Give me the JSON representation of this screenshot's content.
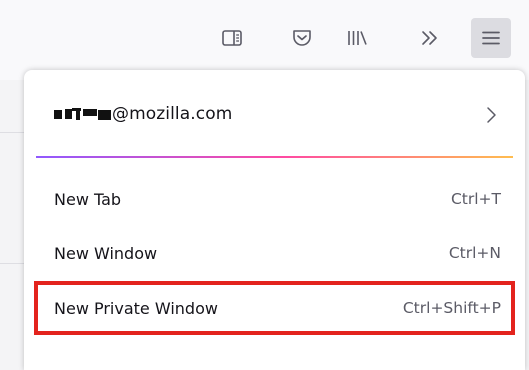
{
  "toolbar": {
    "buttons": [
      {
        "icon": "sidebar-icon",
        "label": "Sidebar"
      },
      {
        "icon": "pocket-icon",
        "label": "Pocket"
      },
      {
        "icon": "library-icon",
        "label": "Library"
      },
      {
        "icon": "overflow-chevron-icon",
        "label": "More tools"
      },
      {
        "icon": "hamburger-menu-icon",
        "label": "Open application menu",
        "active": true
      }
    ]
  },
  "account": {
    "email_suffix": "@mozilla.com"
  },
  "menu": {
    "items": [
      {
        "label": "New Tab",
        "shortcut": "Ctrl+T"
      },
      {
        "label": "New Window",
        "shortcut": "Ctrl+N"
      },
      {
        "label": "New Private Window",
        "shortcut": "Ctrl+Shift+P",
        "highlighted": true
      }
    ]
  },
  "colors": {
    "highlight_border": "#e3231d",
    "gradient": [
      "#9059ff",
      "#ff4aa2",
      "#ffbd4f"
    ],
    "active_button_bg": "#dcdce1"
  }
}
